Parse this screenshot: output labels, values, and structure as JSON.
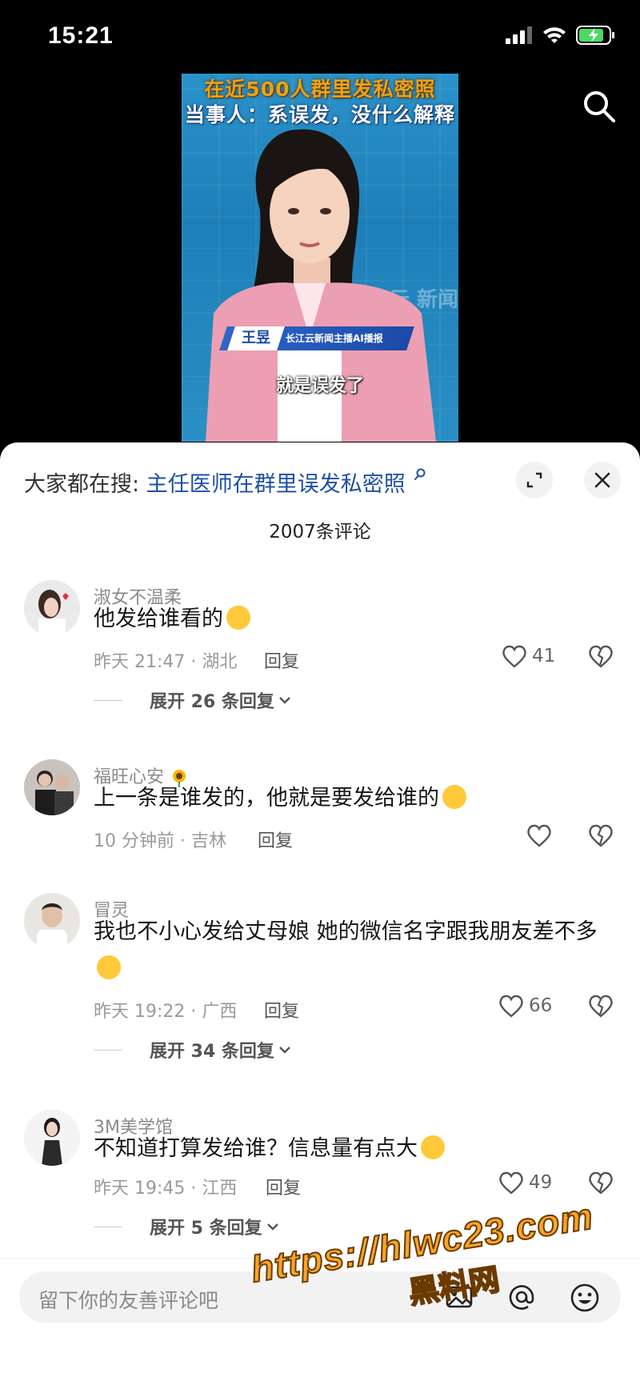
{
  "status_bar": {
    "time": "15:21"
  },
  "video": {
    "headline_line1": "在近500人群里发私密照",
    "headline_line2": "当事人：系误发，没什么解释",
    "name": "王昱",
    "name_title": "长江云新闻主播AI播报",
    "watermark": "长江云 新闻",
    "subtitle": "就是误发了"
  },
  "sheet": {
    "hot_search_prefix": "大家都在搜:",
    "hot_search_query": "主任医师在群里误发私密照",
    "comment_count": "2007条评论"
  },
  "comments": [
    {
      "user": "淑女不温柔",
      "text": "他发给谁看的",
      "time": "昨天 21:47 · 湖北",
      "reply": "回复",
      "likes": "41",
      "expand": "展开 26 条回复"
    },
    {
      "user": "福旺心安",
      "text": "上一条是谁发的，他就是要发给谁的",
      "time": "10 分钟前 · 吉林",
      "reply": "回复",
      "likes": "",
      "expand": ""
    },
    {
      "user": "冒灵",
      "text": "我也不小心发给丈母娘 她的微信名字跟我朋友差不多",
      "time": "昨天 19:22 · 广西",
      "reply": "回复",
      "likes": "66",
      "expand": "展开 34 条回复"
    },
    {
      "user": "3M美学馆",
      "text": "不知道打算发给谁？信息量有点大",
      "time": "昨天 19:45 · 江西",
      "reply": "回复",
      "likes": "49",
      "expand": "展开 5 条回复"
    }
  ],
  "input": {
    "placeholder": "留下你的友善评论吧"
  },
  "promo": {
    "url": "https://hlwc23.com",
    "site_name": "黑料网"
  },
  "icons": [
    "signal-icon",
    "wifi-icon",
    "battery-icon",
    "search-icon",
    "search-small-icon",
    "expand-icon",
    "close-icon",
    "heart-icon",
    "heart-broken-icon",
    "chevron-down-icon",
    "image-icon",
    "at-icon",
    "emoji-icon"
  ],
  "colors": {
    "link": "#1f4fa6",
    "promo": "#f6a52a"
  }
}
